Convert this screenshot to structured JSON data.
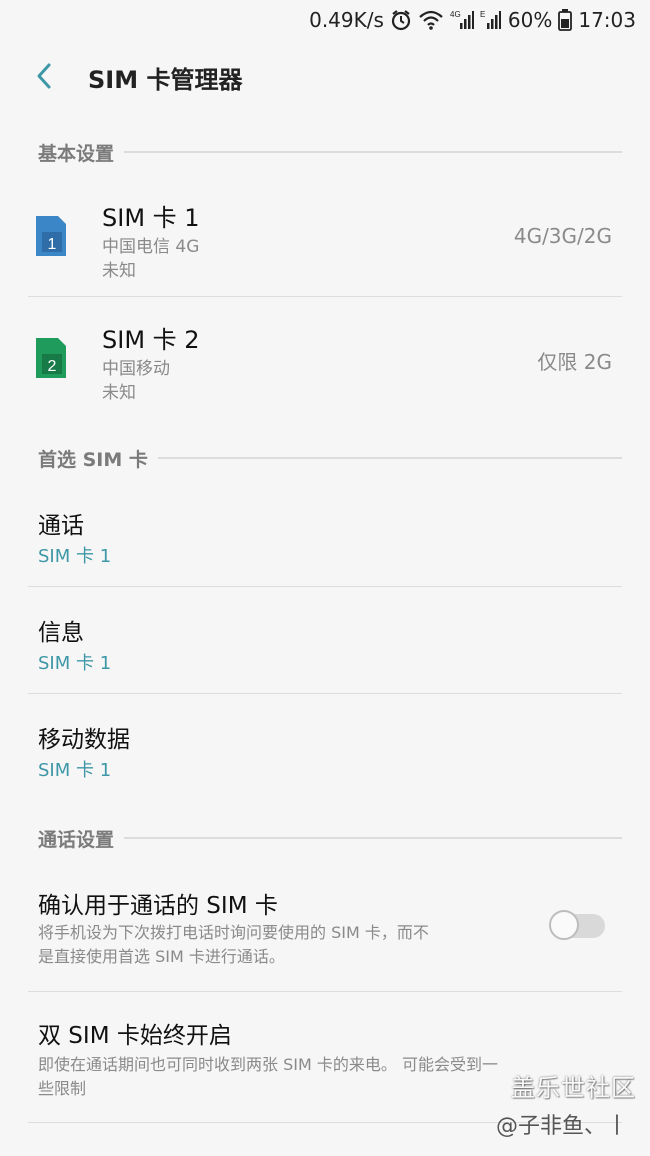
{
  "status_bar": {
    "speed": "0.49K/s",
    "battery": "60%",
    "time": "17:03",
    "icons": [
      "alarm-icon",
      "wifi-icon",
      "signal-4g-icon",
      "signal-e-icon",
      "battery-icon"
    ]
  },
  "app_bar": {
    "title": "SIM 卡管理器",
    "back_icon": "chevron-left-icon"
  },
  "sections": {
    "basic": "基本设置",
    "preferred": "首选 SIM 卡",
    "call_settings": "通话设置"
  },
  "sim_cards": [
    {
      "title": "SIM 卡 1",
      "carrier": "中国电信 4G",
      "number": "未知",
      "network": "4G/3G/2G",
      "badge": "1",
      "color": "#3b86c6"
    },
    {
      "title": "SIM 卡 2",
      "carrier": "中国移动",
      "number": "未知",
      "network": "仅限 2G",
      "badge": "2",
      "color": "#1f9c5b"
    }
  ],
  "preferred": [
    {
      "title": "通话",
      "value": "SIM 卡 1"
    },
    {
      "title": "信息",
      "value": "SIM 卡 1"
    },
    {
      "title": "移动数据",
      "value": "SIM 卡 1"
    }
  ],
  "call_settings": [
    {
      "title": "确认用于通话的 SIM 卡",
      "desc_line1": "将手机设为下次拨打电话时询问要使用的 SIM 卡，而不",
      "desc_line2": "是直接使用首选 SIM 卡进行通话。",
      "toggle_on": false
    },
    {
      "title": "双 SIM 卡始终开启",
      "desc_line1": "即使在通话期间也可同时收到两张 SIM 卡的来电。 可能会受到一",
      "desc_line2": "些限制"
    }
  ],
  "watermark": {
    "line1": "盖乐世社区",
    "line2": "@子非鱼、丨"
  },
  "colors": {
    "accent": "#3d97a6",
    "background": "#f6f6f6",
    "secondary_text": "#8a8a8a"
  }
}
